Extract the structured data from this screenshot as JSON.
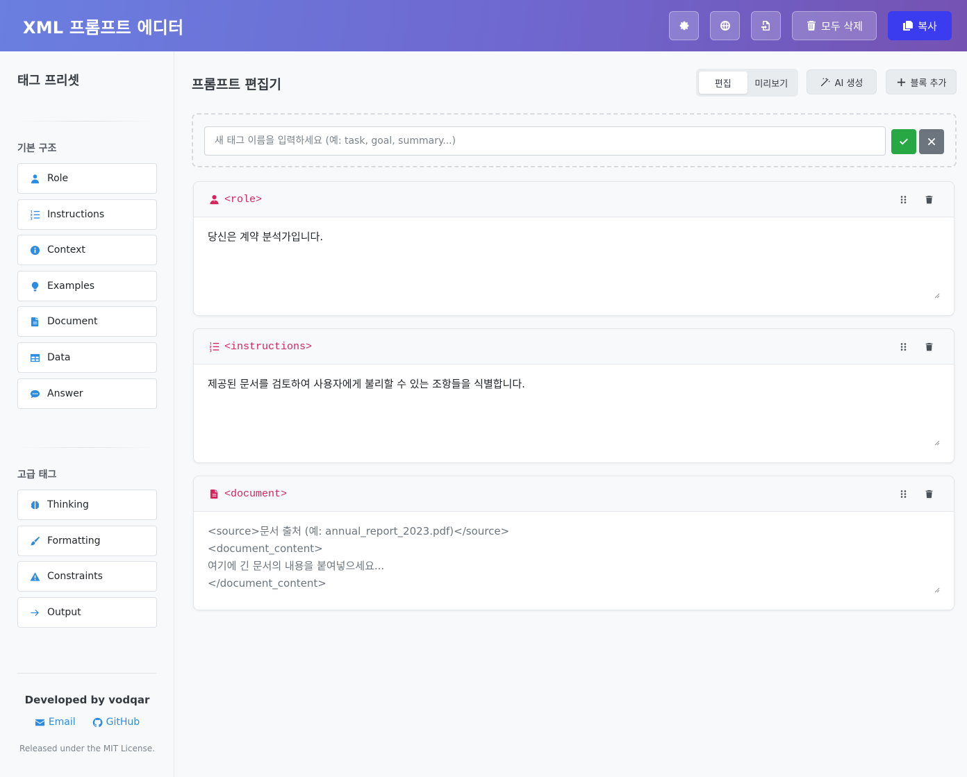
{
  "header": {
    "title": "XML 프롬프트 에디터",
    "clear_all_label": "모두 삭제",
    "copy_label": "복사"
  },
  "sidebar": {
    "title": "태그 프리셋",
    "basic_section": "기본 구조",
    "basic_items": [
      {
        "label": "Role",
        "icon": "user-icon"
      },
      {
        "label": "Instructions",
        "icon": "list-ol-icon"
      },
      {
        "label": "Context",
        "icon": "info-circle-icon"
      },
      {
        "label": "Examples",
        "icon": "lightbulb-icon"
      },
      {
        "label": "Document",
        "icon": "file-icon"
      },
      {
        "label": "Data",
        "icon": "table-icon"
      },
      {
        "label": "Answer",
        "icon": "comment-icon"
      }
    ],
    "advanced_section": "고급 태그",
    "advanced_items": [
      {
        "label": "Thinking",
        "icon": "brain-icon"
      },
      {
        "label": "Formatting",
        "icon": "brush-icon"
      },
      {
        "label": "Constraints",
        "icon": "warning-icon"
      },
      {
        "label": "Output",
        "icon": "arrow-right-icon"
      }
    ],
    "footer": {
      "developed_by": "Developed by vodqar",
      "email_label": "Email",
      "github_label": "GitHub",
      "license": "Released under the MIT License."
    }
  },
  "main": {
    "title": "프롬프트 편집기",
    "view_tabs": [
      {
        "label": "편집",
        "active": true
      },
      {
        "label": "미리보기",
        "active": false
      }
    ],
    "ai_generate_label": "AI 생성",
    "add_block_label": "블록 추가",
    "new_tag": {
      "placeholder": "새 태그 이름을 입력하세요 (예: task, goal, summary...)",
      "value": ""
    },
    "blocks": [
      {
        "tag": "<role>",
        "icon": "user-tie-icon",
        "content": "당신은 계약 분석가입니다."
      },
      {
        "tag": "<instructions>",
        "icon": "list-ol-icon",
        "content": "제공된 문서를 검토하여 사용자에게 불리할 수 있는 조항들을 식별합니다."
      },
      {
        "tag": "<document>",
        "icon": "file-icon",
        "placeholder_lines": [
          "<source>문서 출처 (예: annual_report_2023.pdf)</source>",
          "<document_content>",
          "여기에 긴 문서의 내용을 붙여넣으세요...",
          "</document_content>"
        ]
      }
    ]
  },
  "colors": {
    "header_gradient_start": "#6a7fe0",
    "header_gradient_end": "#7452b2",
    "copy_button": "#3b3cf0",
    "tag_accent": "#d6245c",
    "preset_icon": "#2d8ce0",
    "confirm": "#28a745",
    "cancel": "#6c757d"
  }
}
